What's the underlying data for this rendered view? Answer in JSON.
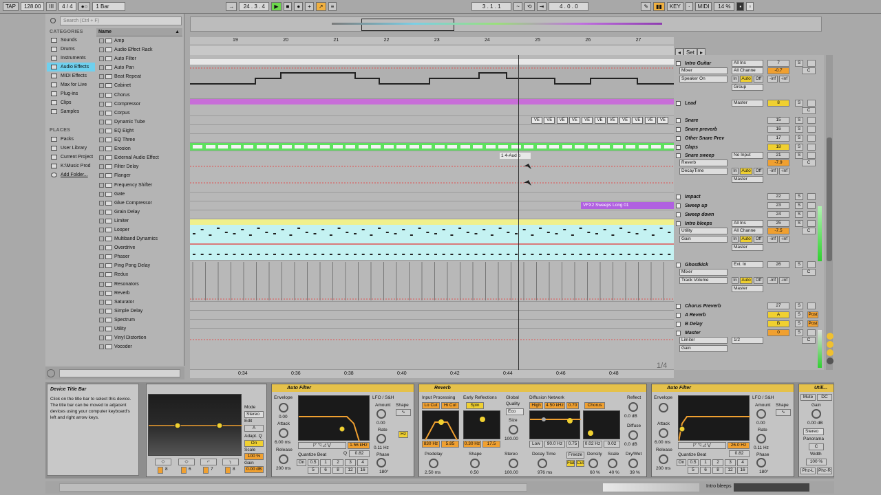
{
  "transport": {
    "tap": "TAP",
    "bpm": "128.00",
    "meter": "4 / 4",
    "quant": "1 Bar",
    "position": "24 . 3 . 4",
    "loop_start": "3 . 1 . 1",
    "loop_length": "4 . 0 . 0",
    "key": "KEY",
    "midi": "MIDI",
    "cpu": "14 %"
  },
  "browser": {
    "search_placeholder": "Search (Ctrl + F)",
    "categories_label": "CATEGORIES",
    "name_header": "Name",
    "places_label": "PLACES",
    "categories": [
      "Sounds",
      "Drums",
      "Instruments",
      "Audio Effects",
      "MIDI Effects",
      "Max for Live",
      "Plug-ins",
      "Clips",
      "Samples"
    ],
    "places": [
      "Packs",
      "User Library",
      "Current Project",
      "K:\\Music Prod",
      "Add Folder..."
    ],
    "items": [
      "Amp",
      "Audio Effect Rack",
      "Auto Filter",
      "Auto Pan",
      "Beat Repeat",
      "Cabinet",
      "Chorus",
      "Compressor",
      "Corpus",
      "Dynamic Tube",
      "EQ Eight",
      "EQ Three",
      "Erosion",
      "External Audio Effect",
      "Filter Delay",
      "Flanger",
      "Frequency Shifter",
      "Gate",
      "Glue Compressor",
      "Grain Delay",
      "Limiter",
      "Looper",
      "Multiband Dynamics",
      "Overdrive",
      "Phaser",
      "Ping Pong Delay",
      "Redux",
      "Resonators",
      "Reverb",
      "Saturator",
      "Simple Delay",
      "Spectrum",
      "Utility",
      "Vinyl Distortion",
      "Vocoder"
    ]
  },
  "ruler": {
    "bars": [
      "19",
      "20",
      "21",
      "22",
      "23",
      "24",
      "25",
      "26",
      "27"
    ],
    "times": [
      "0:34",
      "0:36",
      "0:38",
      "0:40",
      "0:42",
      "0:44",
      "0:46",
      "0:48"
    ],
    "set": "Set"
  },
  "clips": {
    "audio": "1 4-Aud o",
    "sweeps": "VFX2 Sweeps Long 01",
    "ve": "VE"
  },
  "page_indicator": "1/4",
  "tracks": [
    {
      "name": "Intro Guitar",
      "in": "All Ins",
      "ch": "All Channe",
      "dev": "Mixer",
      "param": "Speaker On",
      "out": "Group",
      "vol": "-0.7",
      "num": "7"
    },
    {
      "name": "Lead",
      "out": "Master",
      "num": "8"
    },
    {
      "name": "Snare",
      "num": "15"
    },
    {
      "name": "Snare preverb",
      "num": "16"
    },
    {
      "name": "Other Snare Prev",
      "num": "17"
    },
    {
      "name": "Claps",
      "num": "18"
    },
    {
      "name": "Snare sweep",
      "in": "No Input",
      "dev": "Reverb",
      "param": "DecayTime",
      "out": "Master",
      "vol": "-7.9",
      "num": "21"
    },
    {
      "name": "Impact",
      "num": "22"
    },
    {
      "name": "Sweep up",
      "num": "23"
    },
    {
      "name": "Sweep down",
      "num": "24"
    },
    {
      "name": "Intro bleeps",
      "in": "All Ins",
      "ch": "All Channe",
      "dev": "Utility",
      "param": "Gain",
      "out": "Master",
      "vol": "-7.5",
      "num": "25"
    },
    {
      "name": "Ghostkick",
      "in": "Ext. In",
      "dev": "Mixer",
      "param": "Track Volume",
      "out": "Master",
      "num": "26"
    },
    {
      "name": "Chorus Preverb",
      "num": "27"
    },
    {
      "name": "A Reverb",
      "letter": "A",
      "post": "Post"
    },
    {
      "name": "B Delay",
      "letter": "B",
      "post": "Post"
    },
    {
      "name": "Master",
      "dev": "Limiter",
      "param": "Gain",
      "ch": "1/2",
      "num": "0"
    }
  ],
  "mixer_labels": {
    "in": "In",
    "auto": "Auto",
    "off": "Off",
    "inf": "-inf",
    "s": "S",
    "c": "C",
    "auto_s": "Auto"
  },
  "info": {
    "title": "Device Title Bar",
    "body": "Click on the title bar to select this device. The title bar can be moved to adjacent devices using your computer keyboard's left and right arrow keys."
  },
  "eq": {
    "mode": "Mode",
    "stereo": "Stereo",
    "edit": "Edit",
    "adapt": "Adapt. Q",
    "on": "On",
    "scale": "Scale",
    "scale_val": "100 %",
    "gain": "Gain",
    "gain_val": "0.00 dB",
    "b8": "8",
    "b6": "6",
    "b7": "7",
    "bands_a": "8"
  },
  "autofilter1": {
    "title": "Auto Filter",
    "envelope": "Envelope",
    "env_val": "0.00",
    "attack": "Attack",
    "attack_val": "6.00 ms",
    "release": "Release",
    "release_val": "200 ms",
    "freq": "1.56 kHz",
    "q": "Q",
    "q_val": "0.82",
    "lfo": "LFO / S&H",
    "amount": "Amount",
    "amount_val": "0.00",
    "shape": "Shape",
    "rate": "Rate",
    "rate_val": "0.11 Hz",
    "phase": "Phase",
    "phase_val": "180°",
    "hz": "Hz",
    "qb": "Quantize Beat",
    "on": "On",
    "q_beats": [
      "0.5",
      "1",
      "2",
      "3",
      "4",
      "5",
      "6",
      "8",
      "12",
      "16"
    ]
  },
  "reverb": {
    "title": "Reverb",
    "input": "Input Processing",
    "locut": "Lo Cut",
    "hicut": "Hi Cut",
    "early": "Early Reflections",
    "spin": "Spin",
    "global": "Global",
    "quality": "Quality",
    "eco": "Eco",
    "size": "Size",
    "size_val": "100.00",
    "diffnet": "Diffusion Network",
    "high": "High",
    "high_val": "4.50 kHz",
    "ratio": "0.70",
    "chorus": "Chorus",
    "reflect": "Reflect",
    "reflect_val": "0.0 dB",
    "diffuse": "Diffuse",
    "diffuse_val": "0.0 dB",
    "f1": "830 Hz",
    "f2": "5.85",
    "f3": "0.30 Hz",
    "f4": "17.5",
    "low": "Low",
    "low_val": "90.0 Hz",
    "lowr": "0.75",
    "cf": "0.02 Hz",
    "cf2": "0.02",
    "predelay": "Predelay",
    "predelay_val": "2.50 ms",
    "shape": "Shape",
    "shape_val": "0.50",
    "stereo": "Stereo",
    "stereo_val": "100.00",
    "decay": "Decay Time",
    "decay_val": "976 ms",
    "freeze": "Freeze",
    "flat": "Flat",
    "cut": "Cut",
    "density": "Density",
    "density_val": "60 %",
    "scale": "Scale",
    "scale_val": "40 %",
    "drywet": "Dry/Wet",
    "drywet_val": "39 %"
  },
  "autofilter2": {
    "title": "Auto Filter",
    "envelope": "Envelope",
    "attack": "Attack",
    "attack_val": "6.00 ms",
    "release": "Release",
    "release_val": "200 ms",
    "freq": "26.0 Hz",
    "q_val": "0.82",
    "lfo": "LFO / S&H",
    "amount": "Amount",
    "amount_val": "0.00",
    "shape": "Shape",
    "rate": "Rate",
    "rate_val": "0.11 Hz",
    "phase": "Phase",
    "phase_val": "180°",
    "qb": "Quantize Beat",
    "on": "On",
    "q_beats": [
      "0.5",
      "1",
      "2",
      "3",
      "4",
      "5",
      "6",
      "8",
      "12",
      "16"
    ]
  },
  "utility": {
    "title": "Utili...",
    "mute": "Mute",
    "dc": "DC",
    "gain": "Gain",
    "gain_val": "0.00 dB",
    "stereo": "Stereo",
    "pan": "Panorama",
    "c": "C",
    "width": "Width",
    "width_val": "100 %",
    "phzl": "Phz-L",
    "phzr": "Phz-R"
  },
  "status_track": "Intro bleeps"
}
